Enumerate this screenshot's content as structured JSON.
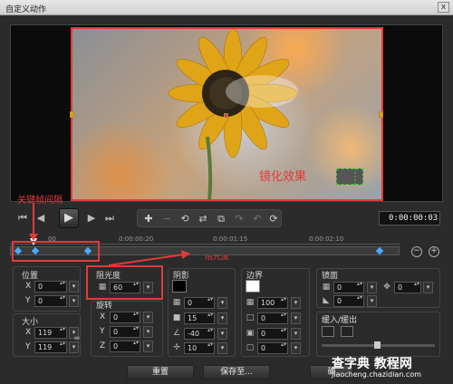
{
  "window": {
    "title": "自定义动作",
    "close_glyph": "x"
  },
  "preview": {
    "annotations": {
      "keyframe_interval": "关键帧间隔",
      "opacity": "阻光度",
      "mosaic_effect": "镜化效果"
    }
  },
  "transport": {
    "timecode": "0:00:00:03"
  },
  "ruler": {
    "ticks": [
      "00",
      "0:00:00:20",
      "0:00:01:15",
      "0:00:02:10"
    ]
  },
  "position": {
    "label": "位置",
    "x_label": "X",
    "x_value": "0",
    "y_label": "Y",
    "y_value": "0"
  },
  "size": {
    "label": "大小",
    "x_label": "X",
    "x_value": "119",
    "y_label": "Y",
    "y_value": "119"
  },
  "opacity": {
    "label": "阻光度",
    "value": "60"
  },
  "rotation": {
    "label": "旋转",
    "x_label": "X",
    "x_value": "0",
    "y_label": "Y",
    "y_value": "0",
    "z_label": "Z",
    "z_value": "0"
  },
  "shadow": {
    "label": "阴影",
    "v1": "0",
    "v2": "15",
    "v3": "-40",
    "v4": "10",
    "color": "#000000"
  },
  "border": {
    "label": "边界",
    "v1": "100",
    "v2": "0",
    "v3": "0",
    "v4": "0",
    "color": "#ffffff"
  },
  "mirror": {
    "label": "镜面",
    "v1": "0",
    "v2": "0",
    "v3": "0"
  },
  "fade": {
    "label": "缓入/缓出"
  },
  "buttons": {
    "reset": "重置",
    "save_as": "保存至...",
    "ok": "确"
  },
  "watermark": {
    "line1": "查字典 教程网",
    "line2": "jiaocheng.chazidian.com"
  }
}
